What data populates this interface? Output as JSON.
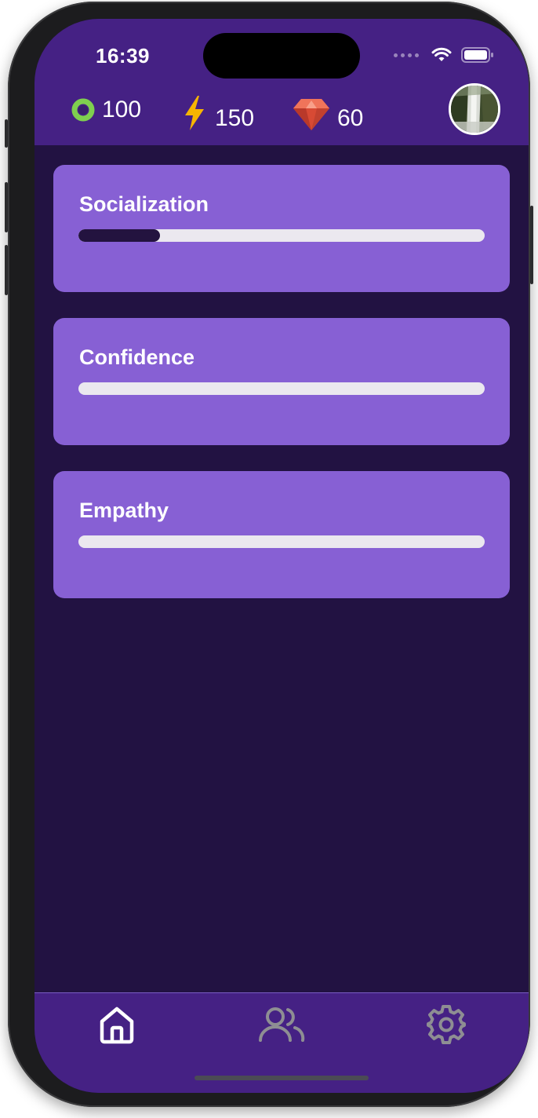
{
  "status_bar": {
    "time": "16:39"
  },
  "header": {
    "stats": [
      {
        "icon": "green-ring-icon",
        "value": "100",
        "color": "#7fcf4f"
      },
      {
        "icon": "lightning-icon",
        "value": "150",
        "color": "#f7b500"
      },
      {
        "icon": "ruby-gem-icon",
        "value": "60",
        "color": "#e0533a"
      }
    ],
    "avatar_icon": "profile-avatar-waterfall"
  },
  "skills": [
    {
      "label": "Socialization",
      "progress": 0.2
    },
    {
      "label": "Confidence",
      "progress": 0.0
    },
    {
      "label": "Empathy",
      "progress": 0.0
    }
  ],
  "tabbar": {
    "tabs": [
      {
        "icon": "home-icon",
        "active": true
      },
      {
        "icon": "users-icon",
        "active": false
      },
      {
        "icon": "gear-icon",
        "active": false
      }
    ]
  },
  "colors": {
    "header_bg": "#452184",
    "page_bg": "#221242",
    "card_bg": "#8760d4",
    "track_bg": "#ebe8ef",
    "fill": "#23133f",
    "tab_active": "#ffffff",
    "tab_inactive": "#8e8e93"
  }
}
